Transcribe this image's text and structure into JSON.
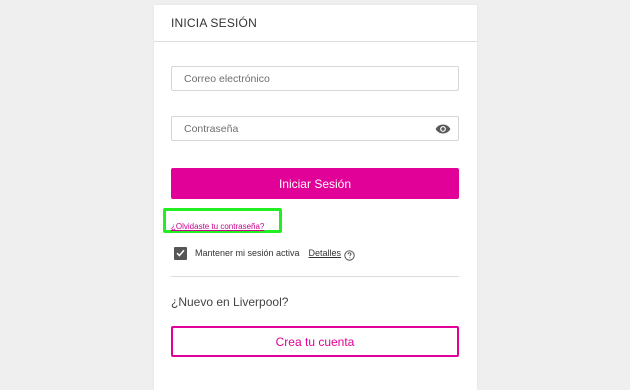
{
  "card": {
    "title": "INICIA SESIÓN"
  },
  "form": {
    "email": {
      "placeholder": "Correo electrónico",
      "value": ""
    },
    "password": {
      "placeholder": "Contraseña",
      "value": "",
      "toggle_icon": "eye-icon"
    },
    "submit_label": "Iniciar Sesión",
    "forgot_label": "¿Olvidaste tu contraseña?",
    "remember": {
      "label": "Mantener mi sesión activa",
      "checked": true,
      "details_label": "Detalles",
      "help_icon": "question-circle-icon"
    }
  },
  "signup": {
    "heading": "¿Nuevo en Liverpool?",
    "button_label": "Crea tu cuenta"
  },
  "colors": {
    "accent": "#e10098",
    "highlight": "#22ee22",
    "background": "#efefef"
  }
}
